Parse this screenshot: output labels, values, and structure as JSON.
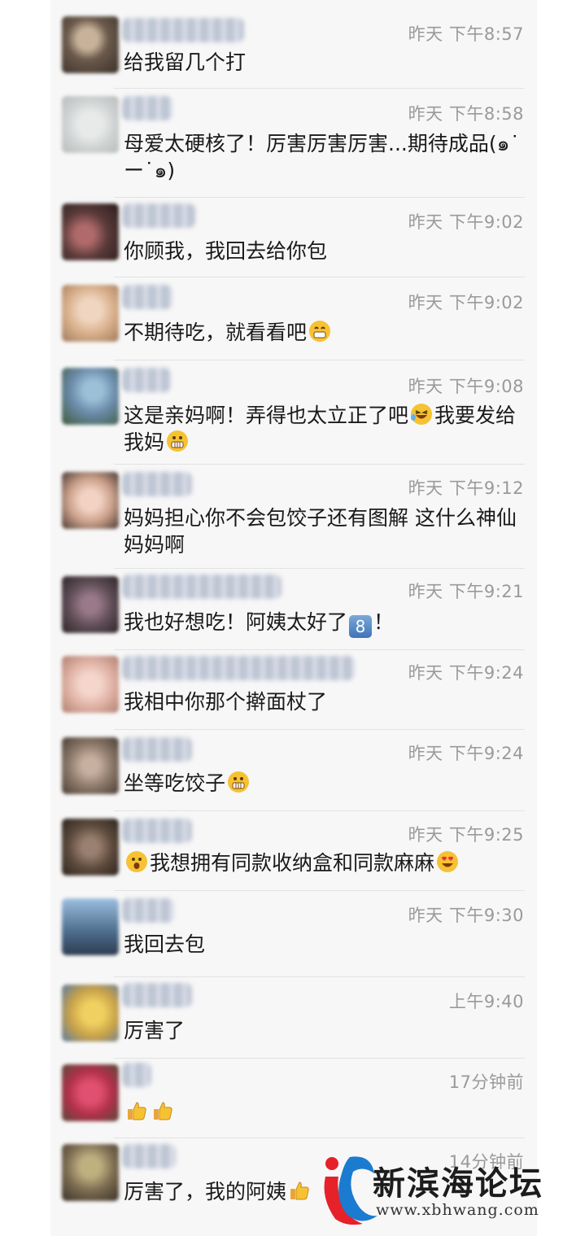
{
  "comments": [
    {
      "time": "昨天 下午8:57",
      "text": "给我留几个打",
      "avatar_color": "#6b5a4c"
    },
    {
      "time": "昨天 下午8:58",
      "text": "母爱太硬核了！厉害厉害厉害...期待成品(๑˙ー˙๑)",
      "avatar_color": "#cfd2d2"
    },
    {
      "time": "昨天 下午9:02",
      "text": "你顾我，我回去给你包",
      "avatar_color": "#5a3a3a"
    },
    {
      "time": "昨天 下午9:02",
      "text": "不期待吃，就看看吧",
      "avatar_color": "#d9b08c",
      "emoji_after": "grin-emoji"
    },
    {
      "time": "昨天 下午9:08",
      "text_a": "这是亲妈啊！弄得也太立正了吧",
      "text_b": "我要发给我妈",
      "avatar_color": "#6a8aa8",
      "emoji_mid": "laugh-tears-emoji",
      "emoji_after": "grimace-emoji"
    },
    {
      "time": "昨天 下午9:12",
      "text": "妈妈担心你不会包饺子还有图解 这什么神仙妈妈啊",
      "avatar_color": "#caa08a"
    },
    {
      "time": "昨天 下午9:21",
      "text_a": "我也好想吃！阿姨太好了",
      "text_b": "！",
      "keycap": "8",
      "avatar_color": "#5e4d55"
    },
    {
      "time": "昨天 下午9:24",
      "text": "我相中你那个擀面杖了",
      "avatar_color": "#e0b3a6"
    },
    {
      "time": "昨天 下午9:24",
      "text": "坐等吃饺子",
      "avatar_color": "#8a7768",
      "emoji_after": "grimace-emoji"
    },
    {
      "time": "昨天 下午9:25",
      "text": "我想拥有同款收纳盒和同款麻麻",
      "avatar_color": "#5c4a3c",
      "emoji_before": "surprised-emoji",
      "emoji_after": "heart-eyes-emoji"
    },
    {
      "time": "昨天 下午9:30",
      "text": "我回去包",
      "avatar_color": "#4d6b8c"
    },
    {
      "time": "上午9:40",
      "text": "厉害了",
      "avatar_color": "#c9a24a"
    },
    {
      "time": "17分钟前",
      "text": "",
      "avatar_color": "#b0304a",
      "emoji_after": "thumbs-up-emoji"
    },
    {
      "time": "14分钟前",
      "text": "厉害了，我的阿姨",
      "avatar_color": "#7a6a50",
      "emoji_after": "thumbs-up-emoji"
    }
  ],
  "watermark": {
    "title": "新滨海论坛",
    "url": "www.xbhwang.com",
    "brand_colors": [
      "#e6212a",
      "#1a7bd0"
    ]
  }
}
